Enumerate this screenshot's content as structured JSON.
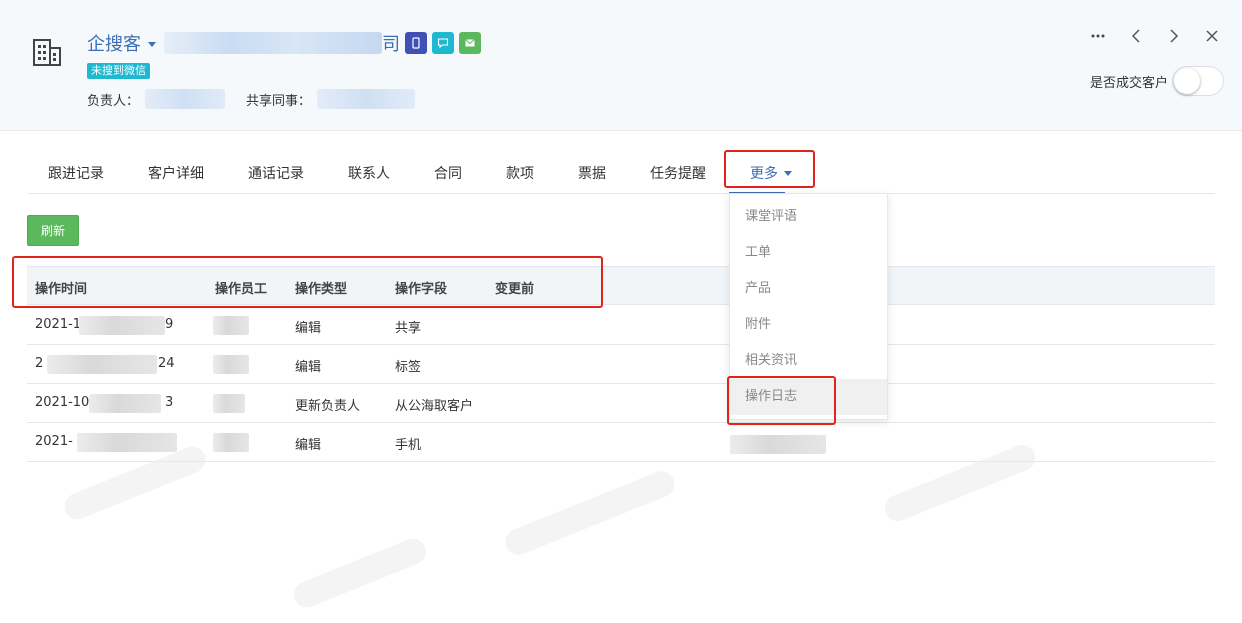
{
  "header": {
    "company_name": "企搜客",
    "name_suffix": "司",
    "wechat_tag": "未搜到微信",
    "owner_label": "负责人：",
    "shared_label": "共享同事：",
    "deal_label": "是否成交客户",
    "deal_toggle_on": false
  },
  "tabs": [
    {
      "label": "跟进记录"
    },
    {
      "label": "客户详细"
    },
    {
      "label": "通话记录"
    },
    {
      "label": "联系人"
    },
    {
      "label": "合同"
    },
    {
      "label": "款项"
    },
    {
      "label": "票据"
    },
    {
      "label": "任务提醒"
    },
    {
      "label": "更多"
    }
  ],
  "toolbar": {
    "refresh_label": "刷新"
  },
  "table": {
    "headers": [
      "操作时间",
      "操作员工",
      "操作类型",
      "操作字段",
      "变更前"
    ],
    "rows": [
      {
        "time_start": "2021-1",
        "time_end": "9",
        "type": "编辑",
        "field": "共享"
      },
      {
        "time_start": "2",
        "time_end": "24",
        "type": "编辑",
        "field": "标签"
      },
      {
        "time_start": "2021-10",
        "time_end": "3",
        "type": "更新负责人",
        "field": "从公海取客户"
      },
      {
        "time_start": "2021-",
        "time_end": "",
        "type": "编辑",
        "field": "手机"
      }
    ]
  },
  "more_menu": {
    "items": [
      {
        "label": "课堂评语"
      },
      {
        "label": "工单"
      },
      {
        "label": "产品"
      },
      {
        "label": "附件"
      },
      {
        "label": "相关资讯"
      },
      {
        "label": "操作日志"
      }
    ],
    "active_index": 5
  },
  "colors": {
    "brand_blue": "#3a6fb7",
    "refresh_green": "#5cb85c",
    "tag_cyan": "#1fb8d1",
    "highlight_red": "#e0241b"
  }
}
